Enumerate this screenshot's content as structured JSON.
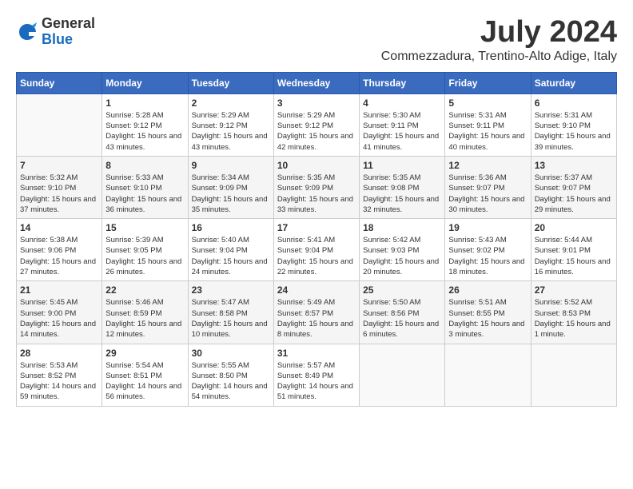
{
  "header": {
    "logo_general": "General",
    "logo_blue": "Blue",
    "month_title": "July 2024",
    "location": "Commezzadura, Trentino-Alto Adige, Italy"
  },
  "columns": [
    "Sunday",
    "Monday",
    "Tuesday",
    "Wednesday",
    "Thursday",
    "Friday",
    "Saturday"
  ],
  "weeks": [
    [
      {
        "day": "",
        "sunrise": "",
        "sunset": "",
        "daylight": ""
      },
      {
        "day": "1",
        "sunrise": "Sunrise: 5:28 AM",
        "sunset": "Sunset: 9:12 PM",
        "daylight": "Daylight: 15 hours and 43 minutes."
      },
      {
        "day": "2",
        "sunrise": "Sunrise: 5:29 AM",
        "sunset": "Sunset: 9:12 PM",
        "daylight": "Daylight: 15 hours and 43 minutes."
      },
      {
        "day": "3",
        "sunrise": "Sunrise: 5:29 AM",
        "sunset": "Sunset: 9:12 PM",
        "daylight": "Daylight: 15 hours and 42 minutes."
      },
      {
        "day": "4",
        "sunrise": "Sunrise: 5:30 AM",
        "sunset": "Sunset: 9:11 PM",
        "daylight": "Daylight: 15 hours and 41 minutes."
      },
      {
        "day": "5",
        "sunrise": "Sunrise: 5:31 AM",
        "sunset": "Sunset: 9:11 PM",
        "daylight": "Daylight: 15 hours and 40 minutes."
      },
      {
        "day": "6",
        "sunrise": "Sunrise: 5:31 AM",
        "sunset": "Sunset: 9:10 PM",
        "daylight": "Daylight: 15 hours and 39 minutes."
      }
    ],
    [
      {
        "day": "7",
        "sunrise": "Sunrise: 5:32 AM",
        "sunset": "Sunset: 9:10 PM",
        "daylight": "Daylight: 15 hours and 37 minutes."
      },
      {
        "day": "8",
        "sunrise": "Sunrise: 5:33 AM",
        "sunset": "Sunset: 9:10 PM",
        "daylight": "Daylight: 15 hours and 36 minutes."
      },
      {
        "day": "9",
        "sunrise": "Sunrise: 5:34 AM",
        "sunset": "Sunset: 9:09 PM",
        "daylight": "Daylight: 15 hours and 35 minutes."
      },
      {
        "day": "10",
        "sunrise": "Sunrise: 5:35 AM",
        "sunset": "Sunset: 9:09 PM",
        "daylight": "Daylight: 15 hours and 33 minutes."
      },
      {
        "day": "11",
        "sunrise": "Sunrise: 5:35 AM",
        "sunset": "Sunset: 9:08 PM",
        "daylight": "Daylight: 15 hours and 32 minutes."
      },
      {
        "day": "12",
        "sunrise": "Sunrise: 5:36 AM",
        "sunset": "Sunset: 9:07 PM",
        "daylight": "Daylight: 15 hours and 30 minutes."
      },
      {
        "day": "13",
        "sunrise": "Sunrise: 5:37 AM",
        "sunset": "Sunset: 9:07 PM",
        "daylight": "Daylight: 15 hours and 29 minutes."
      }
    ],
    [
      {
        "day": "14",
        "sunrise": "Sunrise: 5:38 AM",
        "sunset": "Sunset: 9:06 PM",
        "daylight": "Daylight: 15 hours and 27 minutes."
      },
      {
        "day": "15",
        "sunrise": "Sunrise: 5:39 AM",
        "sunset": "Sunset: 9:05 PM",
        "daylight": "Daylight: 15 hours and 26 minutes."
      },
      {
        "day": "16",
        "sunrise": "Sunrise: 5:40 AM",
        "sunset": "Sunset: 9:04 PM",
        "daylight": "Daylight: 15 hours and 24 minutes."
      },
      {
        "day": "17",
        "sunrise": "Sunrise: 5:41 AM",
        "sunset": "Sunset: 9:04 PM",
        "daylight": "Daylight: 15 hours and 22 minutes."
      },
      {
        "day": "18",
        "sunrise": "Sunrise: 5:42 AM",
        "sunset": "Sunset: 9:03 PM",
        "daylight": "Daylight: 15 hours and 20 minutes."
      },
      {
        "day": "19",
        "sunrise": "Sunrise: 5:43 AM",
        "sunset": "Sunset: 9:02 PM",
        "daylight": "Daylight: 15 hours and 18 minutes."
      },
      {
        "day": "20",
        "sunrise": "Sunrise: 5:44 AM",
        "sunset": "Sunset: 9:01 PM",
        "daylight": "Daylight: 15 hours and 16 minutes."
      }
    ],
    [
      {
        "day": "21",
        "sunrise": "Sunrise: 5:45 AM",
        "sunset": "Sunset: 9:00 PM",
        "daylight": "Daylight: 15 hours and 14 minutes."
      },
      {
        "day": "22",
        "sunrise": "Sunrise: 5:46 AM",
        "sunset": "Sunset: 8:59 PM",
        "daylight": "Daylight: 15 hours and 12 minutes."
      },
      {
        "day": "23",
        "sunrise": "Sunrise: 5:47 AM",
        "sunset": "Sunset: 8:58 PM",
        "daylight": "Daylight: 15 hours and 10 minutes."
      },
      {
        "day": "24",
        "sunrise": "Sunrise: 5:49 AM",
        "sunset": "Sunset: 8:57 PM",
        "daylight": "Daylight: 15 hours and 8 minutes."
      },
      {
        "day": "25",
        "sunrise": "Sunrise: 5:50 AM",
        "sunset": "Sunset: 8:56 PM",
        "daylight": "Daylight: 15 hours and 6 minutes."
      },
      {
        "day": "26",
        "sunrise": "Sunrise: 5:51 AM",
        "sunset": "Sunset: 8:55 PM",
        "daylight": "Daylight: 15 hours and 3 minutes."
      },
      {
        "day": "27",
        "sunrise": "Sunrise: 5:52 AM",
        "sunset": "Sunset: 8:53 PM",
        "daylight": "Daylight: 15 hours and 1 minute."
      }
    ],
    [
      {
        "day": "28",
        "sunrise": "Sunrise: 5:53 AM",
        "sunset": "Sunset: 8:52 PM",
        "daylight": "Daylight: 14 hours and 59 minutes."
      },
      {
        "day": "29",
        "sunrise": "Sunrise: 5:54 AM",
        "sunset": "Sunset: 8:51 PM",
        "daylight": "Daylight: 14 hours and 56 minutes."
      },
      {
        "day": "30",
        "sunrise": "Sunrise: 5:55 AM",
        "sunset": "Sunset: 8:50 PM",
        "daylight": "Daylight: 14 hours and 54 minutes."
      },
      {
        "day": "31",
        "sunrise": "Sunrise: 5:57 AM",
        "sunset": "Sunset: 8:49 PM",
        "daylight": "Daylight: 14 hours and 51 minutes."
      },
      {
        "day": "",
        "sunrise": "",
        "sunset": "",
        "daylight": ""
      },
      {
        "day": "",
        "sunrise": "",
        "sunset": "",
        "daylight": ""
      },
      {
        "day": "",
        "sunrise": "",
        "sunset": "",
        "daylight": ""
      }
    ]
  ]
}
